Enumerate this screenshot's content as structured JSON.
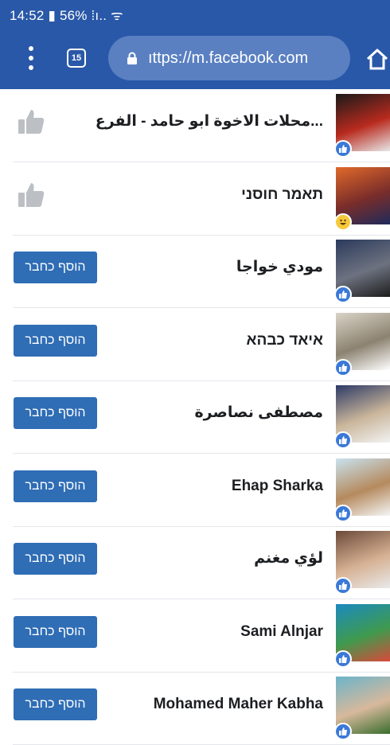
{
  "status_bar": {
    "time_battery": "14:52 ▮ 56% ⁞ı.. ᯤ"
  },
  "browser": {
    "url": "ıttps://m.facebook.com",
    "tab_count": "15"
  },
  "add_friend_label": "הוסף כחבר",
  "rows": [
    {
      "name": "محلات الاخوة ابو حامد - الفرع...",
      "action": "like",
      "thumb_colors": [
        "#1a1a1a",
        "#b82a1e",
        "#e7e7e7"
      ],
      "badge": "like"
    },
    {
      "name": "תאמר חוסני",
      "action": "like",
      "thumb_colors": [
        "#e0692a",
        "#7a2d2a",
        "#1f2a5a"
      ],
      "badge": "haha"
    },
    {
      "name": "مودي خواجا",
      "action": "add",
      "thumb_colors": [
        "#2b3a5c",
        "#6d7280",
        "#1d1d1d"
      ],
      "badge": "like"
    },
    {
      "name": "איאד כבהא",
      "action": "add",
      "thumb_colors": [
        "#d9d4c8",
        "#8c8270",
        "#ffffff"
      ],
      "badge": "like"
    },
    {
      "name": "مصطفى نصاصرة",
      "action": "add",
      "thumb_colors": [
        "#2d3a66",
        "#c9b59a",
        "#f2f2f2"
      ],
      "badge": "like"
    },
    {
      "name": "Ehap Sharka",
      "action": "add",
      "thumb_colors": [
        "#c9e2ef",
        "#b58a5e",
        "#f5f5f5"
      ],
      "badge": "like"
    },
    {
      "name": "لؤي مغنم",
      "action": "add",
      "thumb_colors": [
        "#6b4a3a",
        "#d6b092",
        "#e9e9e9"
      ],
      "badge": "like"
    },
    {
      "name": "Sami Alnjar",
      "action": "add",
      "thumb_colors": [
        "#1b8ac0",
        "#3f9a4e",
        "#d84a3a"
      ],
      "badge": "like"
    },
    {
      "name": "Mohamed Maher Kabha",
      "action": "add",
      "thumb_colors": [
        "#6bb4c9",
        "#d8b89c",
        "#3a6e2e"
      ],
      "badge": "like"
    }
  ]
}
